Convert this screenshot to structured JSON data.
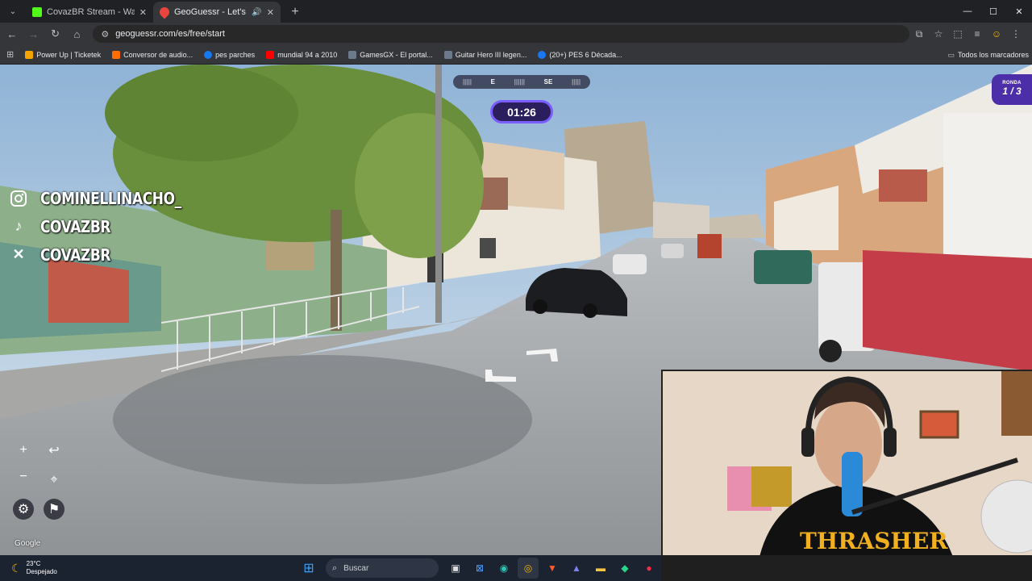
{
  "browser": {
    "tabs": [
      {
        "title": "CovazBR Stream - Watch Live o",
        "icon": "kick-icon",
        "color": "#53fc18",
        "active": false
      },
      {
        "title": "GeoGuessr - Let's explore t",
        "icon": "geoguessr-icon",
        "color": "#e8453c",
        "active": true
      }
    ],
    "url": "geoguessr.com/es/free/start",
    "bookmarks": [
      {
        "label": "Power Up | Ticketek",
        "color": "#f4a300"
      },
      {
        "label": "Conversor de audio...",
        "color": "#ff6d00"
      },
      {
        "label": "pes parches",
        "color": "#1877f2"
      },
      {
        "label": "mundial 94 a 2010",
        "color": "#ff0000"
      },
      {
        "label": "GamesGX - El portal...",
        "color": "#6b7b8c"
      },
      {
        "label": "Guitar Hero III legen...",
        "color": "#6b7b8c"
      },
      {
        "label": "(20+) PES 6 Década...",
        "color": "#1877f2"
      }
    ],
    "bookmarks_right": "Todos los marcadores"
  },
  "game": {
    "compass": [
      "E",
      "SE"
    ],
    "timer": "01:26",
    "round_label": "RONDA",
    "round_value": "1 / 3",
    "attribution": "Google"
  },
  "overlay": {
    "socials": [
      {
        "icon": "instagram-icon",
        "handle": "COMINELLINACHO_"
      },
      {
        "icon": "tiktok-icon",
        "handle": "COVAZBR"
      },
      {
        "icon": "x-icon",
        "handle": "COVAZBR"
      }
    ],
    "shirt_text": "THRASHER"
  },
  "taskbar": {
    "temperature": "23°C",
    "condition": "Despejado",
    "search_placeholder": "Buscar"
  }
}
